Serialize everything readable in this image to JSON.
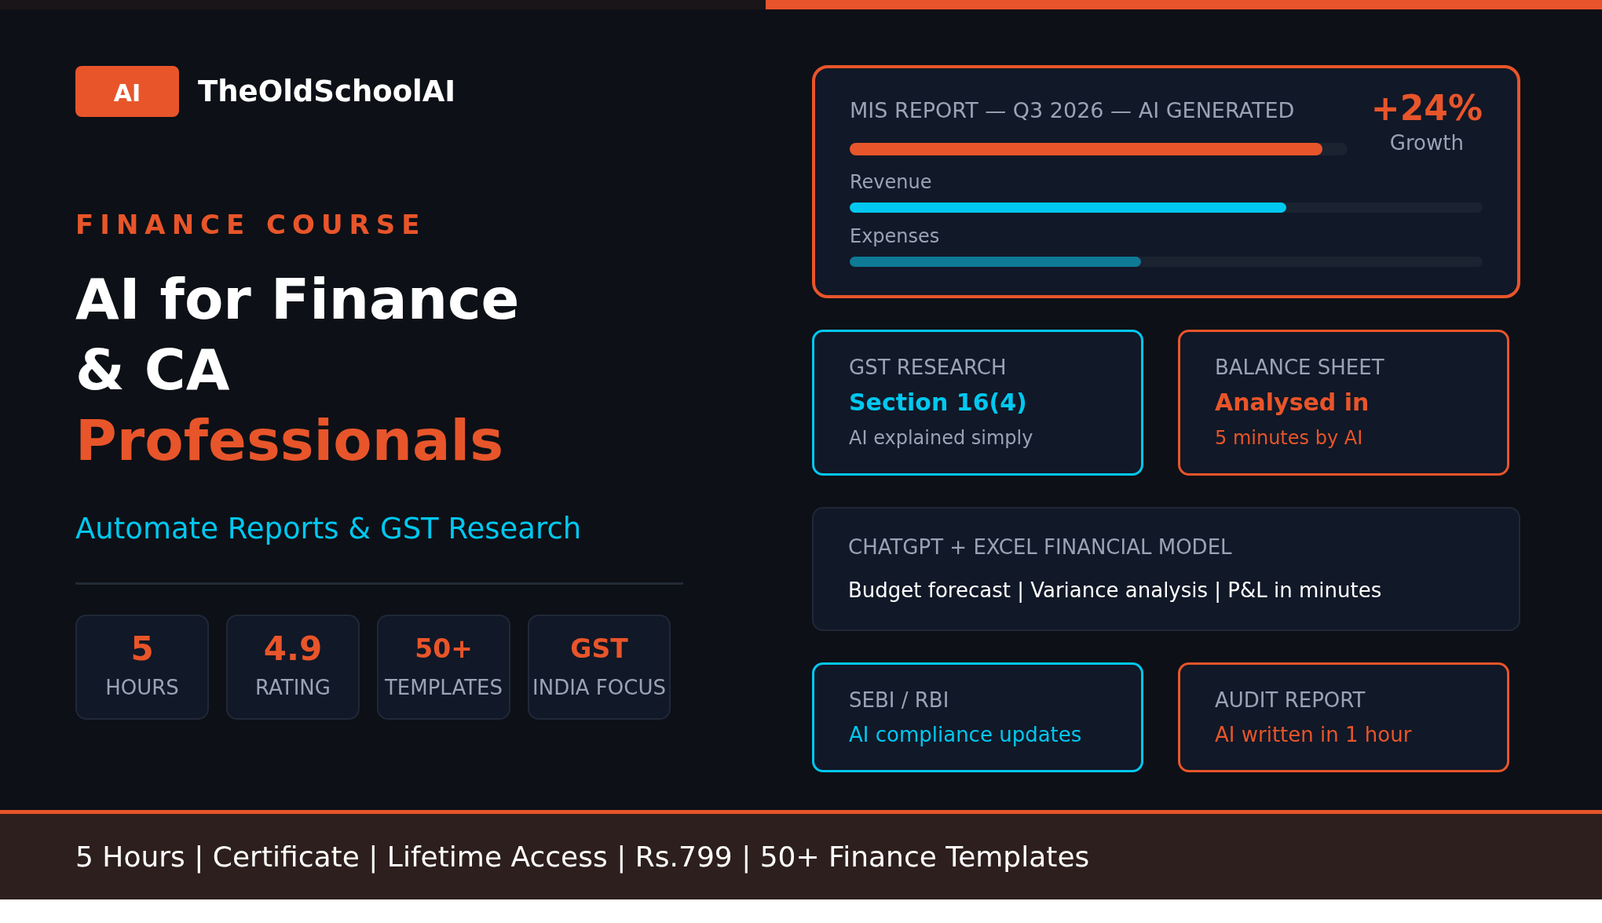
{
  "brand": {
    "badge": "AI",
    "name": "TheOldSchoolAI"
  },
  "eyebrow": "FINANCE COURSE",
  "title": {
    "lines": [
      "AI for Finance",
      "& CA"
    ],
    "accent": "Professionals"
  },
  "subtitle": "Automate Reports & GST Research",
  "stats": [
    {
      "value": "5",
      "label": "HOURS",
      "big": true
    },
    {
      "value": "4.9",
      "label": "RATING",
      "big": true
    },
    {
      "value": "50+",
      "label": "TEMPLATES",
      "big": false
    },
    {
      "value": "GST",
      "label": "INDIA FOCUS",
      "big": false
    }
  ],
  "mis_card": {
    "title": "MIS REPORT — Q3 2026 — AI GENERATED",
    "level": 0.95,
    "growth_value": "+24%",
    "growth_label": "Growth",
    "bars": [
      {
        "label": "Revenue",
        "level": 0.69,
        "color": "#00c8f0"
      },
      {
        "label": "Expenses",
        "level": 0.46,
        "color": "#0e7a96"
      }
    ]
  },
  "cards": [
    {
      "kind": "pair",
      "items": [
        {
          "color": "#00c8f0",
          "label": "GST RESEARCH",
          "headline": "Section 16(4)",
          "note": "AI explained simply",
          "note_muted": true
        },
        {
          "color": "#e8552a",
          "label": "BALANCE SHEET",
          "headline": "Analysed in",
          "note": "5 minutes by AI",
          "note_muted": false
        }
      ]
    },
    {
      "kind": "wide",
      "label": "CHATGPT + EXCEL FINANCIAL MODEL",
      "note": "Budget forecast | Variance analysis | P&L in minutes"
    },
    {
      "kind": "pair",
      "items": [
        {
          "color": "#00c8f0",
          "label": "SEBI / RBI",
          "note": "AI compliance updates",
          "note_muted": false
        },
        {
          "color": "#e8552a",
          "label": "AUDIT REPORT",
          "note": "AI written in 1 hour",
          "note_muted": false
        }
      ]
    }
  ],
  "footer": "5 Hours | Certificate | Lifetime Access | Rs.799 | 50+ Finance Templates"
}
